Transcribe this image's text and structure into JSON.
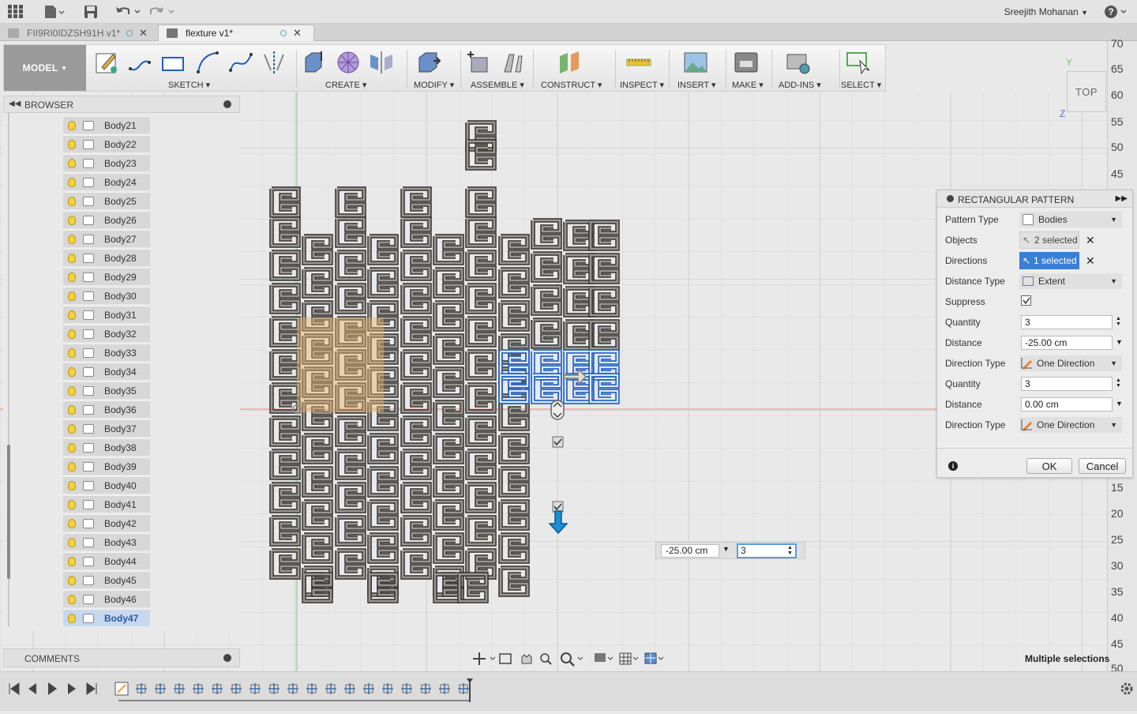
{
  "user": "Sreejith Mohanan",
  "tabs": [
    {
      "label": "FII9RI0IDZSH91H v1*"
    },
    {
      "label": "flexture v1*"
    }
  ],
  "toolbar": {
    "workspace": "MODEL",
    "groups": [
      "SKETCH",
      "CREATE",
      "MODIFY",
      "ASSEMBLE",
      "CONSTRUCT",
      "INSPECT",
      "INSERT",
      "MAKE",
      "ADD-INS",
      "SELECT"
    ]
  },
  "browser": {
    "title": "BROWSER",
    "items": [
      "Body21",
      "Body22",
      "Body23",
      "Body24",
      "Body25",
      "Body26",
      "Body27",
      "Body28",
      "Body29",
      "Body30",
      "Body31",
      "Body32",
      "Body33",
      "Body34",
      "Body35",
      "Body36",
      "Body37",
      "Body38",
      "Body39",
      "Body40",
      "Body41",
      "Body42",
      "Body43",
      "Body44",
      "Body45",
      "Body46",
      "Body47"
    ],
    "selected": "Body47"
  },
  "comments": {
    "title": "COMMENTS"
  },
  "viewcube": {
    "label": "TOP",
    "axis_y": "Y",
    "axis_z": "Z",
    "axis_x": "X"
  },
  "ruler": [
    "70",
    "65",
    "60",
    "55",
    "50",
    "45",
    "15",
    "20",
    "25",
    "30",
    "35",
    "40",
    "45",
    "50"
  ],
  "panel": {
    "title": "RECTANGULAR PATTERN",
    "rows": [
      {
        "label": "Pattern Type",
        "value": "Bodies"
      },
      {
        "label": "Objects",
        "value": "2 selected"
      },
      {
        "label": "Directions",
        "value": "1 selected"
      },
      {
        "label": "Distance Type",
        "value": "Extent"
      },
      {
        "label": "Suppress",
        "value": "checked"
      },
      {
        "label": "Quantity",
        "value": "3"
      },
      {
        "label": "Distance",
        "value": "-25.00 cm"
      },
      {
        "label": "Direction Type",
        "value": "One Direction"
      },
      {
        "label": "Quantity",
        "value": "3"
      },
      {
        "label": "Distance",
        "value": "0.00 cm"
      },
      {
        "label": "Direction Type",
        "value": "One Direction"
      }
    ],
    "ok": "OK",
    "cancel": "Cancel"
  },
  "dim_input": {
    "distance": "-25.00 cm",
    "quantity": "3"
  },
  "status": "Multiple selections",
  "colors": {
    "selection_blue": "#1f5fbf",
    "highlight_orange": "#e7b36a",
    "body_gray": "#8e8a86"
  }
}
